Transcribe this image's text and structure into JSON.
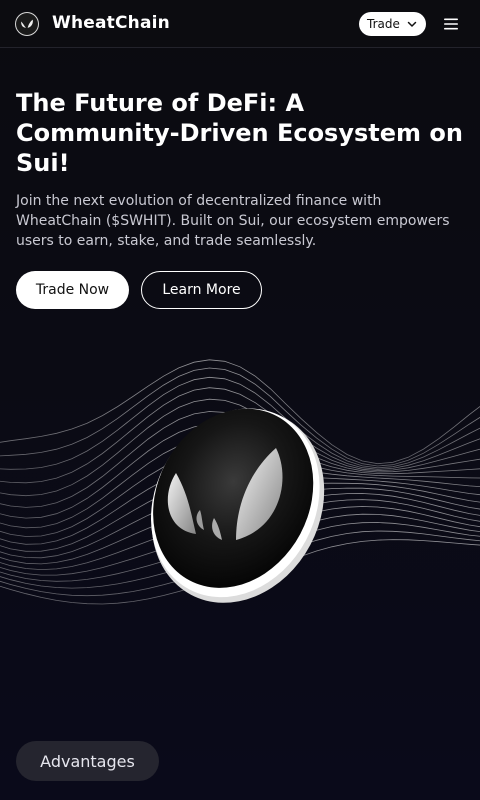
{
  "header": {
    "brand": "WheatChain",
    "logo_icon": "wheat-leaf-icon",
    "trade_select": {
      "selected": "Trade",
      "icon": "chevron-down-icon"
    },
    "menu_icon": "hamburger-menu-icon"
  },
  "hero": {
    "title": "The Future of DeFi: A Community-Driven Ecosystem on Sui!",
    "description": "Join the next evolution of decentralized finance with WheatChain ($SWHIT). Built on Sui, our ecosystem empowers users to earn, stake, and trade seamlessly.",
    "primary_button": "Trade Now",
    "secondary_button": "Learn More"
  },
  "illustration": {
    "coin_icon": "wheat-leaf-icon",
    "wave": "wireframe-wave-mesh"
  },
  "advantages": {
    "label": "Advantages"
  },
  "colors": {
    "background": "#0a0a14",
    "text_primary": "#ffffff",
    "text_secondary": "#c9c9d2",
    "pill_bg": "#25252f"
  }
}
